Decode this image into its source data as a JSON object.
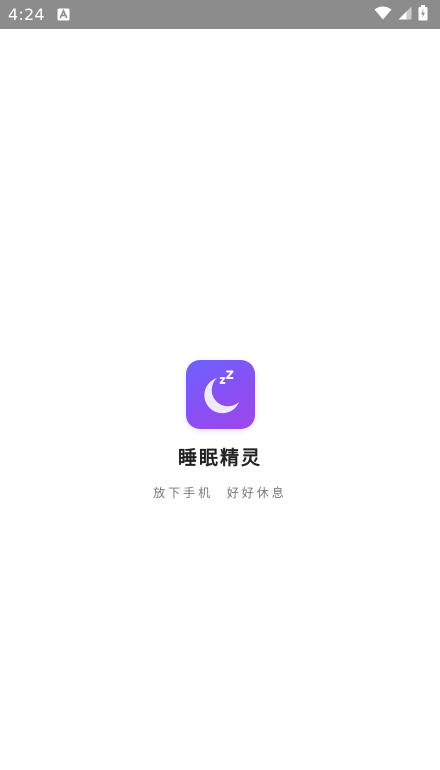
{
  "status_bar": {
    "time": "4:24",
    "background": "#8c8c8c",
    "icons": [
      "app-notification-icon",
      "wifi-icon",
      "cell-signal-icon",
      "battery-icon"
    ]
  },
  "splash": {
    "app_name": "睡眠精灵",
    "slogan": "放下手机  好好休息",
    "icon": "moon-zzz-icon",
    "icon_gradient": [
      "#6b63ff",
      "#9d46ea"
    ]
  }
}
